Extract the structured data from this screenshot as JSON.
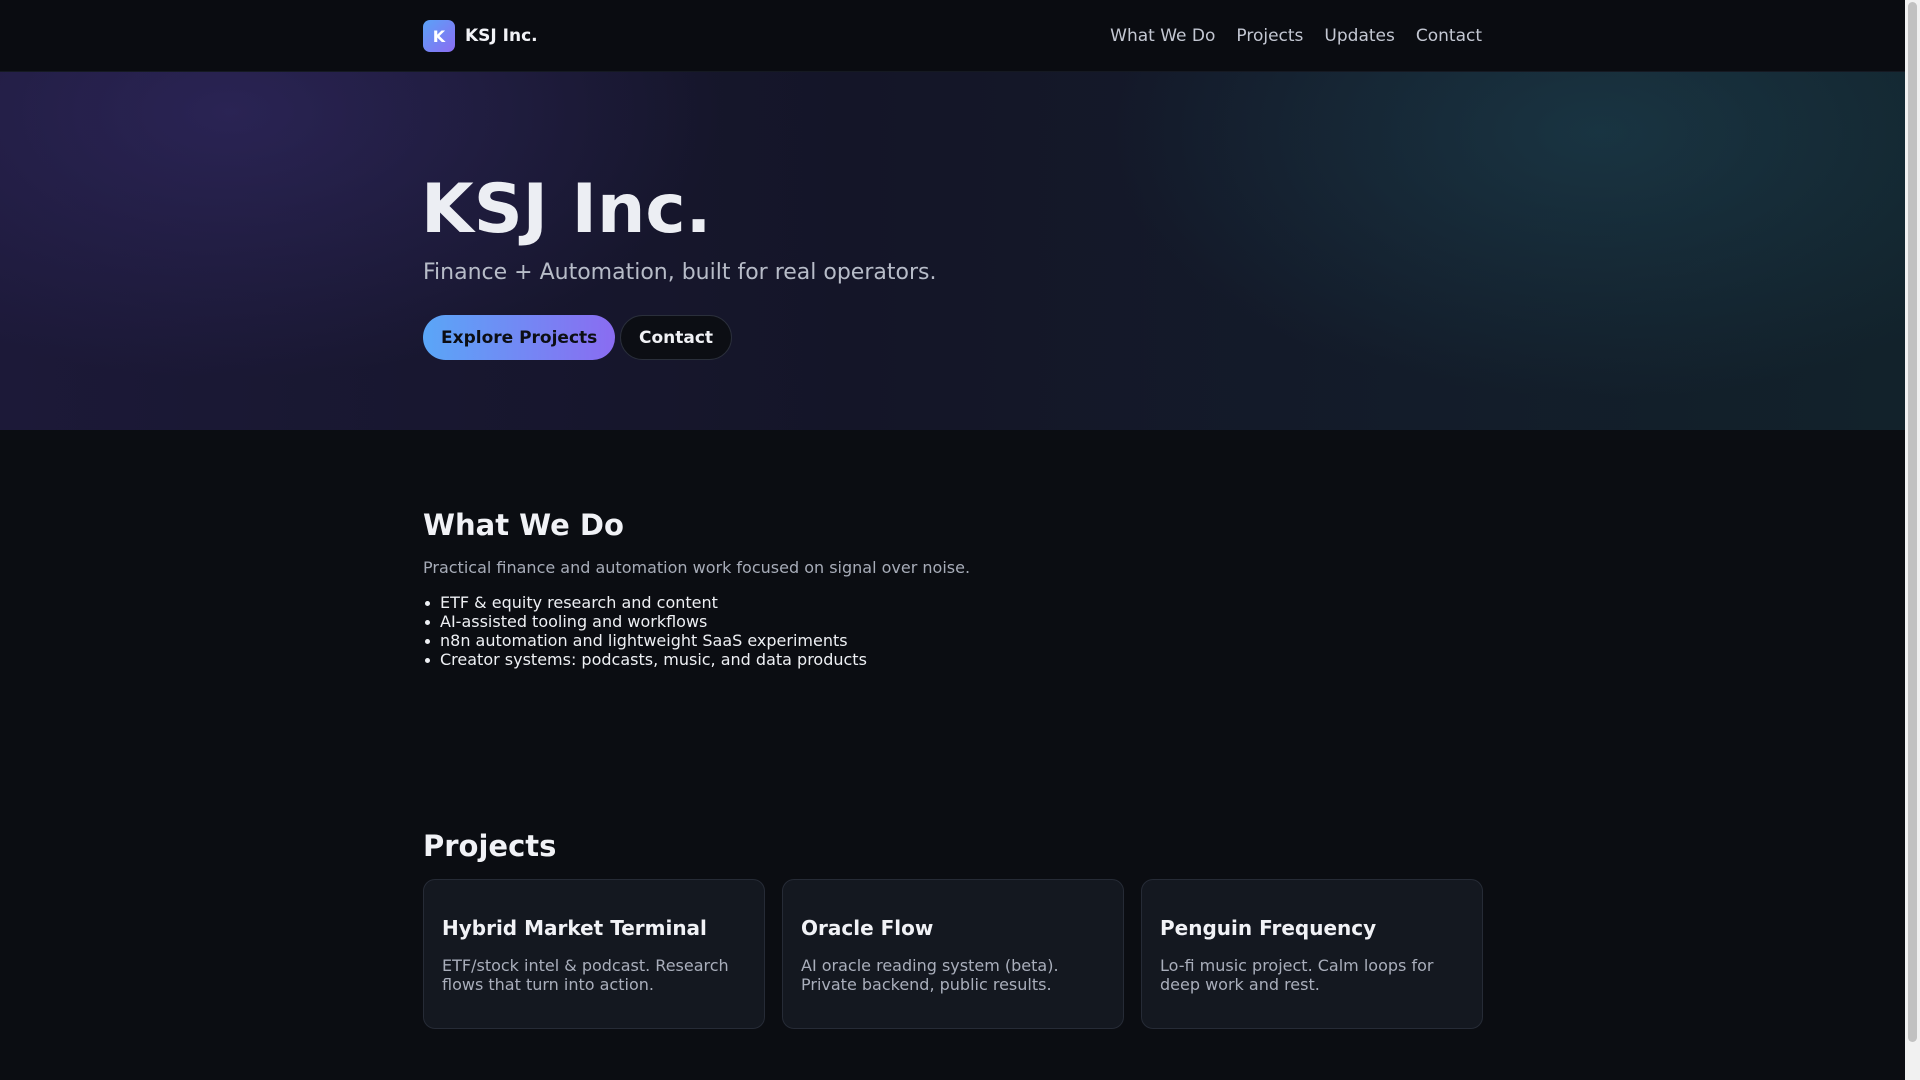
{
  "header": {
    "logo_letter": "K",
    "brand": "KSJ Inc.",
    "nav": [
      "What We Do",
      "Projects",
      "Updates",
      "Contact"
    ]
  },
  "hero": {
    "title": "KSJ Inc.",
    "subtitle": "Finance + Automation, built for real operators.",
    "primary_button": "Explore Projects",
    "secondary_button": "Contact"
  },
  "what_we_do": {
    "title": "What We Do",
    "description": "Practical finance and automation work focused on signal over noise.",
    "items": [
      "ETF & equity research and content",
      "AI-assisted tooling and workflows",
      "n8n automation and lightweight SaaS experiments",
      "Creator systems: podcasts, music, and data products"
    ]
  },
  "projects": {
    "title": "Projects",
    "cards": [
      {
        "title": "Hybrid Market Terminal",
        "line1": "ETF/stock intel & podcast. Research",
        "line2": "flows that turn into action."
      },
      {
        "title": "Oracle Flow",
        "line1": "AI oracle reading system (beta).",
        "line2": "Private backend, public results."
      },
      {
        "title": "Penguin Frequency",
        "line1": "Lo-fi music project. Calm loops for",
        "line2": "deep work and rest."
      }
    ]
  },
  "colors": {
    "accent_start": "#5aa6f7",
    "accent_end": "#8a6cf1",
    "background": "#0b0d12"
  }
}
